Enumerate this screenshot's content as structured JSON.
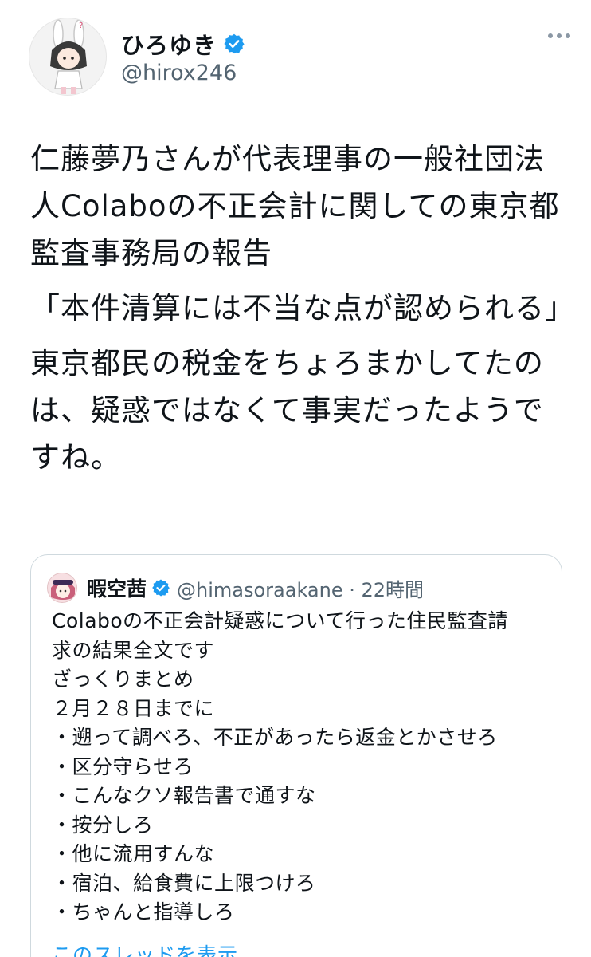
{
  "author": {
    "display_name": "ひろゆき",
    "handle": "@hirox246"
  },
  "tweet": {
    "paragraphs": [
      "仁藤夢乃さんが代表理事の一般社団法人Colaboの不正会計に関しての東京都監査事務局の報告",
      "「本件清算には不当な点が認められる」",
      "東京都民の税金をちょろまかしてたのは、疑惑ではなくて事実だったようですね。"
    ]
  },
  "quoted": {
    "display_name": "暇空茜",
    "handle_time": "@himasoraakane · 22時間",
    "lines": [
      "Colaboの不正会計疑惑について行った住民監査請",
      "求の結果全文です",
      "ざっくりまとめ",
      "２月２８日までに",
      "・遡って調べろ、不正があったら返金とかさせろ",
      "・区分守らせろ",
      "・こんなクソ報告書で通すな",
      "・按分しろ",
      "・他に流用すんな",
      "・宿泊、給食費に上限つけろ",
      "・ちゃんと指導しろ"
    ],
    "show_thread": "このスレッドを表示"
  },
  "colors": {
    "verified": "#1d9bf0",
    "link": "#1d9bf0",
    "secondary_text": "#536471"
  },
  "icons": {
    "verified": "verified-badge-icon",
    "more": "more-options-icon"
  }
}
